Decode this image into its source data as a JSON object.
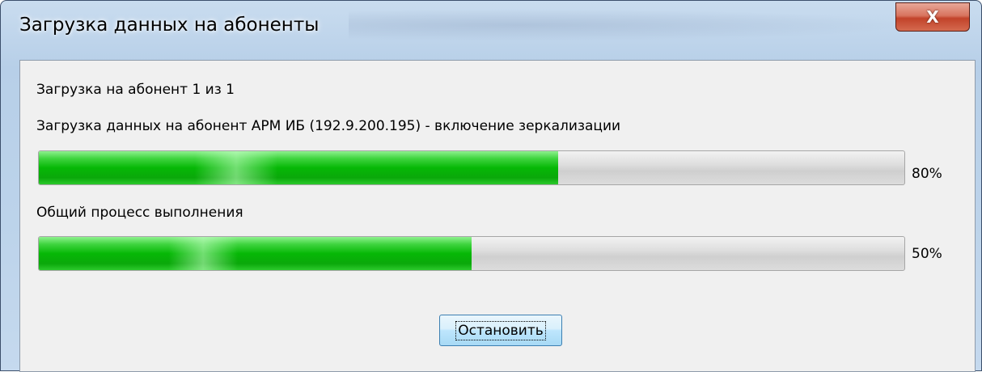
{
  "window": {
    "title": "Загрузка данных на абоненты",
    "close_label": "X"
  },
  "status": {
    "subscriber_line": "Загрузка на абонент 1 из 1",
    "operation_line": "Загрузка данных на абонент АРМ ИБ (192.9.200.195) - включение зеркализации"
  },
  "progress": {
    "current": {
      "value": 0.6,
      "label": "80%"
    },
    "overall": {
      "caption": "Общий процесс выполнения",
      "value": 0.5,
      "label": "50%"
    }
  },
  "buttons": {
    "stop_label": "Остановить"
  },
  "colors": {
    "progress_green": "#06b806",
    "close_red": "#c2432a",
    "title_glass": "#b7cfe8"
  }
}
